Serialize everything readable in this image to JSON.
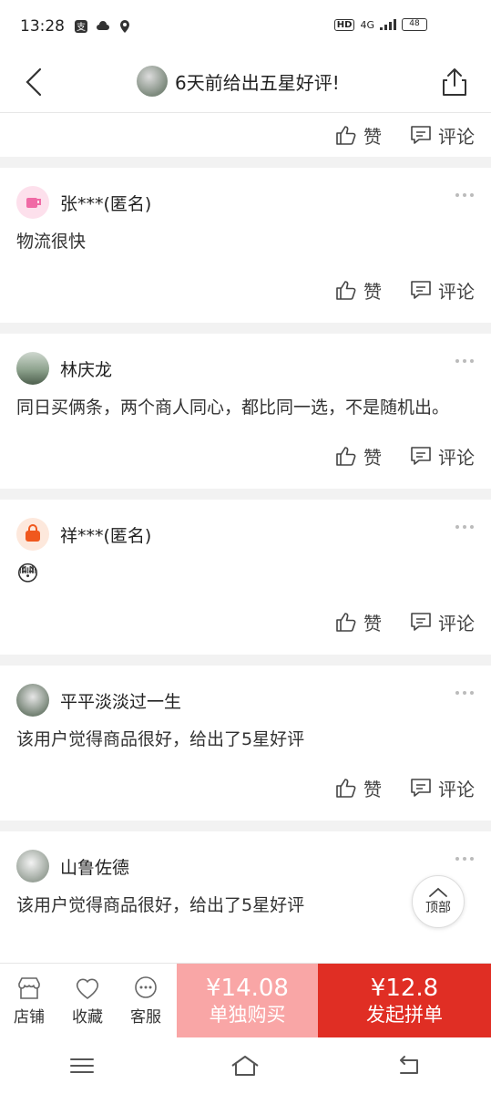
{
  "status": {
    "time": "13:28",
    "network": "4G",
    "battery": "48"
  },
  "nav": {
    "title": "6天前给出五星好评!"
  },
  "actions": {
    "like": "赞",
    "comment": "评论"
  },
  "reviews": [
    {
      "user": "张***(匿名)",
      "text": "物流很快",
      "avatar": "cup-icon"
    },
    {
      "user": "林庆龙",
      "text": "同日买俩条，两个商人同心，都比同一选，不是随机出。",
      "avatar": "landscape-photo"
    },
    {
      "user": "祥***(匿名)",
      "text": "😳",
      "avatar": "bag-icon"
    },
    {
      "user": "平平淡淡过一生",
      "text": "该用户觉得商品很好，给出了5星好评",
      "avatar": "photo"
    },
    {
      "user": "山鲁佐德",
      "text": "该用户觉得商品很好，给出了5星好评",
      "avatar": "photo"
    }
  ],
  "top_button": {
    "label": "顶部"
  },
  "bottom": {
    "store": "店铺",
    "favorite": "收藏",
    "service": "客服",
    "single_price": "¥14.08",
    "single_label": "单独购买",
    "group_price": "¥12.8",
    "group_label": "发起拼单"
  },
  "colors": {
    "brand_red": "#e02e24",
    "light_red": "#f9a6a6"
  }
}
